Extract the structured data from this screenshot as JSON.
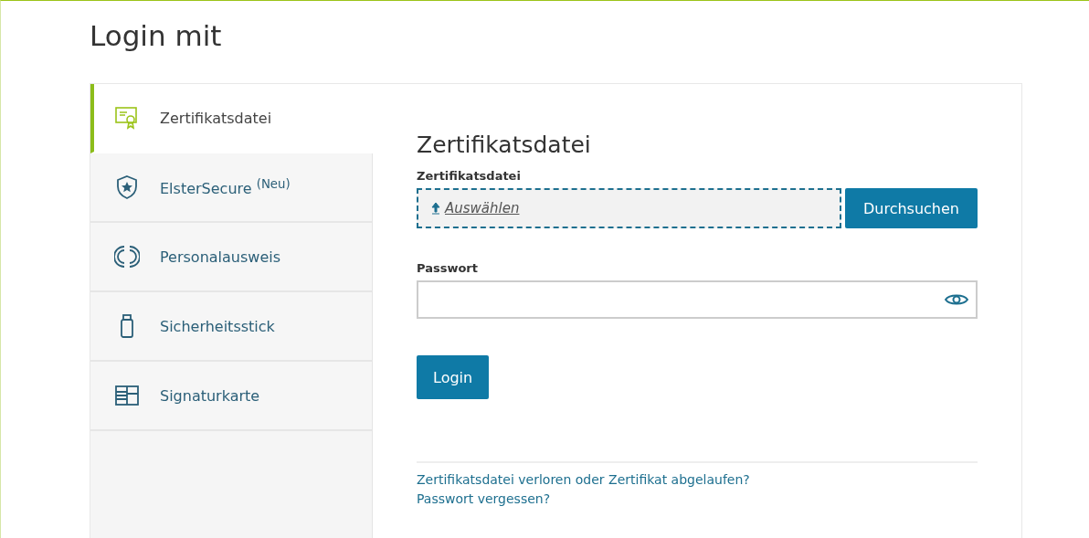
{
  "title": "Login mit",
  "methods": [
    {
      "label": "Zertifikatsdatei",
      "kind": "certificate",
      "selected": true
    },
    {
      "label": "ElsterSecure $^{(Neu)}$",
      "kind": "shield",
      "selected": false
    },
    {
      "label": "Personalausweis",
      "kind": "idcard",
      "selected": false
    },
    {
      "label": "Sicherheitsstick",
      "kind": "stick",
      "selected": false
    },
    {
      "label": "Signaturkarte",
      "kind": "card",
      "selected": false
    }
  ],
  "form": {
    "heading": "Zertifikatsdatei",
    "file_label": "Zertifikatsdatei",
    "file_link": "Auswählen",
    "browse_button": "Durchsuchen",
    "password_label": "Passwort",
    "login_button": "Login"
  },
  "links": [
    "Zertifikatsdatei verloren oder Zertifikat abgelaufen?",
    "Passwort vergessen?"
  ]
}
